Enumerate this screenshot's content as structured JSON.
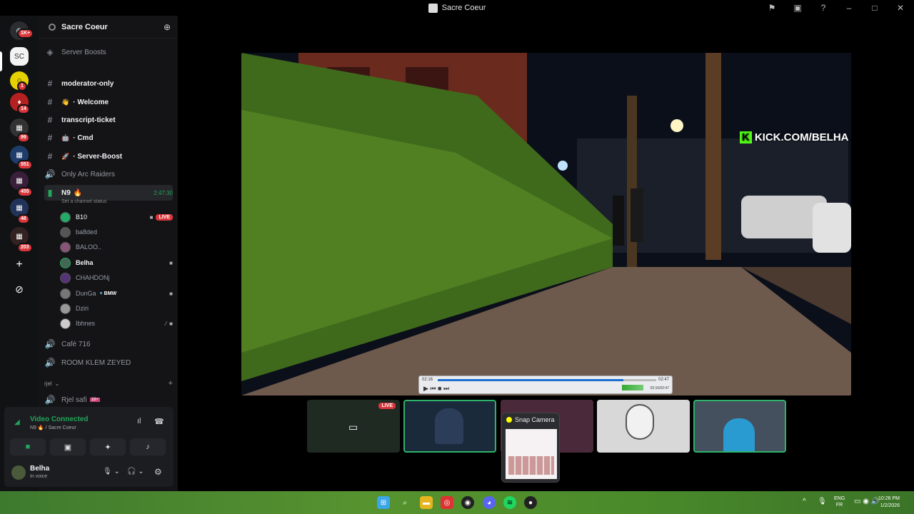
{
  "window": {
    "title": "Sacre Coeur"
  },
  "guilds": [
    {
      "badge": "1K+"
    },
    {
      "badge": ""
    },
    {
      "badge": "1"
    },
    {
      "badge": "14"
    },
    {
      "badge": "99"
    },
    {
      "badge": "551"
    },
    {
      "badge": "455"
    },
    {
      "badge": "48"
    },
    {
      "badge": "203"
    }
  ],
  "server": {
    "name": "Sacre Coeur"
  },
  "channels": {
    "server_boosts": "Server Boosts",
    "moderator_only": "moderator-only",
    "welcome": "· Welcome",
    "transcript": "transcript-ticket",
    "cmd": "· Cmd",
    "server_boost": "· Server-Boost",
    "only_arc": "Only Arc Raiders",
    "n9": "N9",
    "n9_time": "2:47:30",
    "n9_status": "Set a channel status",
    "cafe": "Café 716",
    "room": "ROOM KLEM ZEYED",
    "category": "rjel",
    "rjel_safi": "Rjel safi"
  },
  "members": [
    {
      "name": "B10",
      "live": "LIVE"
    },
    {
      "name": "ba8ded"
    },
    {
      "name": "BALOO.."
    },
    {
      "name": "Belha"
    },
    {
      "name": "CHAHDONj"
    },
    {
      "name": "DunGa",
      "tag": "BMW"
    },
    {
      "name": "Dziri"
    },
    {
      "name": "Ibhnes"
    }
  ],
  "voice": {
    "status": "Video Connected",
    "channel": "N9 🔥 / Sacre Coeur"
  },
  "user": {
    "name": "Belha",
    "status": "In voice"
  },
  "stream": {
    "overlay": "KICK.COM/BELHA",
    "player_left": "02:16",
    "player_right": "02:47",
    "player_total": "02:16/02:47",
    "progress": 0.85
  },
  "thumbs": [
    {
      "live": "LIVE"
    }
  ],
  "snap": {
    "title": "Snap Camera"
  },
  "taskbar": {
    "lang1": "ENG",
    "lang2": "FR",
    "time": "10:26 PM",
    "date": "1/2/2026"
  }
}
